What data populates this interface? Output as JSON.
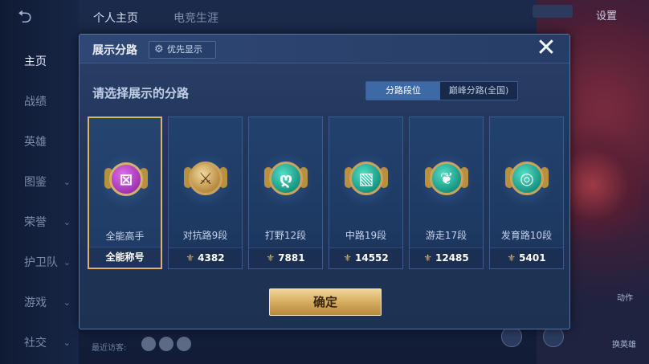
{
  "background": {
    "top_tabs": [
      "个人主页",
      "电竞生涯"
    ],
    "settings_label": "设置",
    "recent_visitors_label": "最近访客:",
    "left_nav": [
      {
        "label": "主页",
        "active": true,
        "has_chevron": false
      },
      {
        "label": "战绩",
        "active": false,
        "has_chevron": false
      },
      {
        "label": "英雄",
        "active": false,
        "has_chevron": false
      },
      {
        "label": "图鉴",
        "active": false,
        "has_chevron": true
      },
      {
        "label": "荣誉",
        "active": false,
        "has_chevron": true
      },
      {
        "label": "护卫队",
        "active": false,
        "has_chevron": true
      },
      {
        "label": "游戏",
        "active": false,
        "has_chevron": true
      },
      {
        "label": "社交",
        "active": false,
        "has_chevron": true
      }
    ],
    "side_labels": [
      "动作",
      "换英雄"
    ]
  },
  "modal": {
    "title": "展示分路",
    "priority_button": "优先显示",
    "close_icon": "close-icon",
    "subtitle": "请选择展示的分路",
    "segments": [
      {
        "label": "分路段位",
        "active": true
      },
      {
        "label": "巅峰分路(全国)",
        "active": false
      }
    ],
    "cards": [
      {
        "name": "全能高手",
        "footer": "全能称号",
        "score": null,
        "selected": true,
        "badge_style": "purple",
        "glyph": "⊠"
      },
      {
        "name": "对抗路9段",
        "footer": "4382",
        "score": 4382,
        "selected": false,
        "badge_style": "gold",
        "glyph": "⚔"
      },
      {
        "name": "打野12段",
        "footer": "7881",
        "score": 7881,
        "selected": false,
        "badge_style": "teal",
        "glyph": "ღ"
      },
      {
        "name": "中路19段",
        "footer": "14552",
        "score": 14552,
        "selected": false,
        "badge_style": "teal",
        "glyph": "▧"
      },
      {
        "name": "游走17段",
        "footer": "12485",
        "score": 12485,
        "selected": false,
        "badge_style": "teal",
        "glyph": "❦"
      },
      {
        "name": "发育路10段",
        "footer": "5401",
        "score": 5401,
        "selected": false,
        "badge_style": "teal",
        "glyph": "◎"
      }
    ],
    "confirm_button": "确定"
  },
  "colors": {
    "accent_gold": "#d9b56a",
    "segment_active": "#3d6aa6",
    "panel_bg": "#213659"
  }
}
